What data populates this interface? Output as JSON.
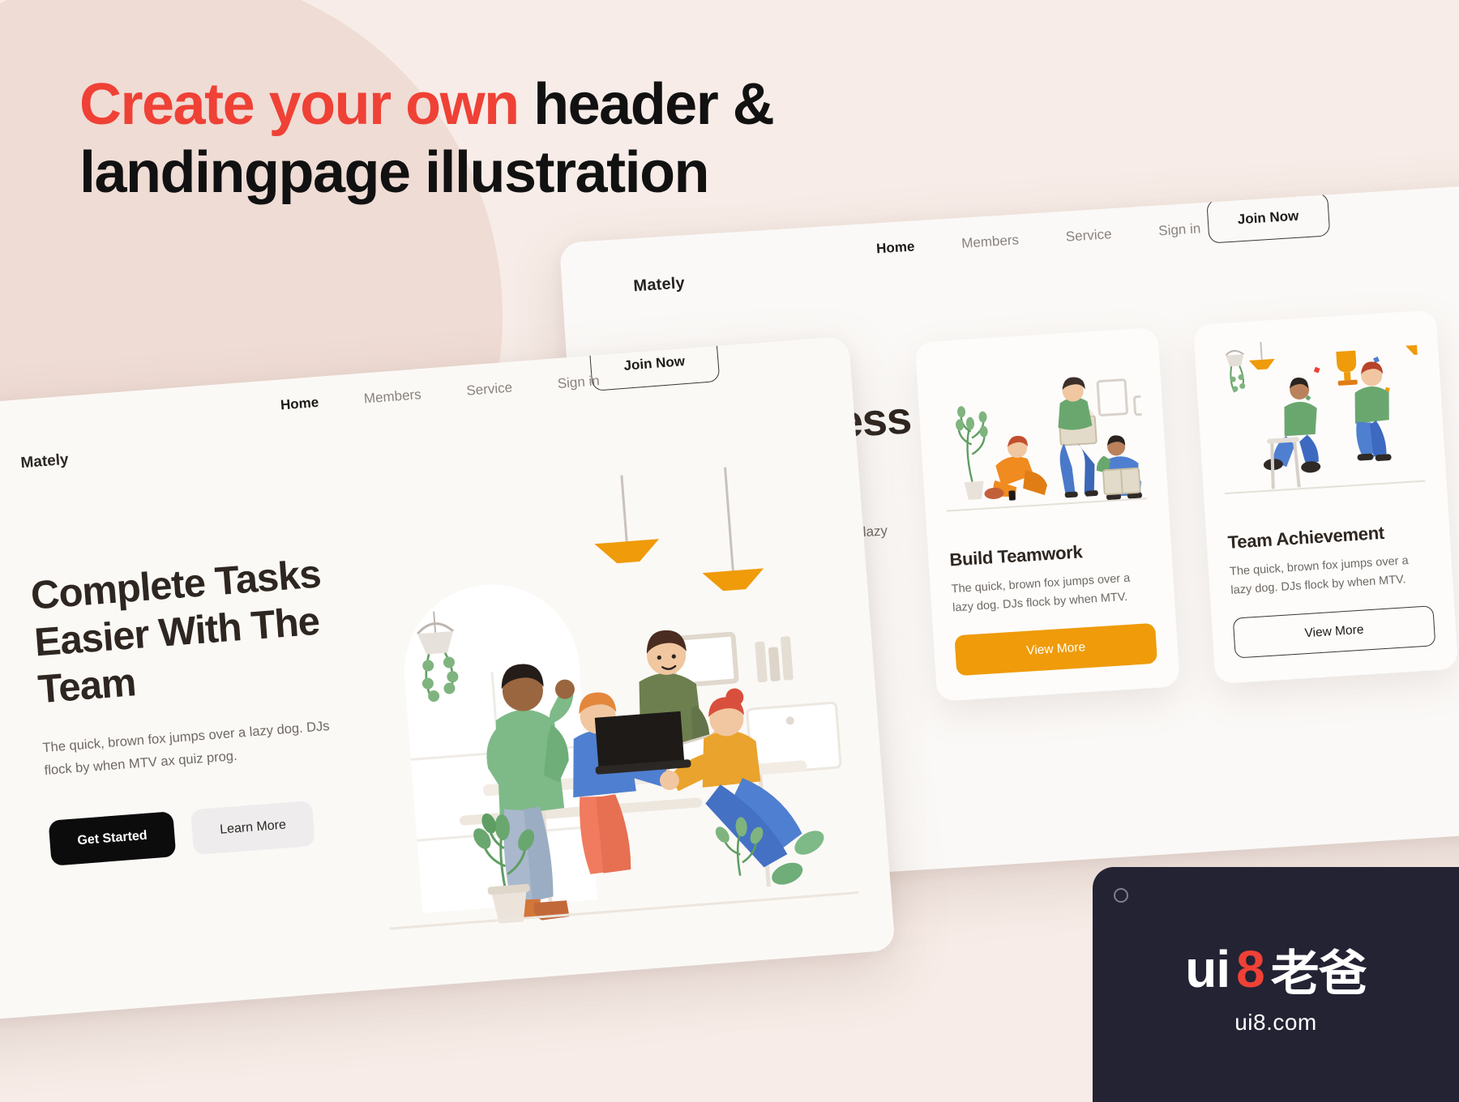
{
  "promo": {
    "line1_accent": "Create your own ",
    "line1_rest": "header &",
    "line2": "landingpage illustration",
    "accent_color": "#ef4136"
  },
  "front_mock": {
    "logo": "Mately",
    "nav": [
      {
        "label": "Home",
        "active": true
      },
      {
        "label": "Members",
        "active": false
      },
      {
        "label": "Service",
        "active": false
      },
      {
        "label": "Sign in",
        "active": false
      }
    ],
    "join_button": "Join Now",
    "hero": {
      "title": "Complete Tasks Easier With The Team",
      "paragraph": "The quick, brown fox jumps over a lazy dog. DJs flock by when MTV ax quiz prog.",
      "primary_button": "Get Started",
      "secondary_button": "Learn More"
    }
  },
  "back_mock": {
    "logo": "Mately",
    "nav": [
      {
        "label": "Home",
        "active": true
      },
      {
        "label": "Members",
        "active": false
      },
      {
        "label": "Service",
        "active": false
      },
      {
        "label": "Sign in",
        "active": false
      }
    ],
    "join_button": "Join Now",
    "hero": {
      "title": "The Success Is Your",
      "paragraph": "The quick, brown fox jumps over a lazy dog. DJs flock by when"
    },
    "cards": [
      {
        "title": "Build Teamwork",
        "paragraph": "The quick, brown fox jumps over a lazy dog. DJs flock by when MTV.",
        "button": "View More",
        "button_style": "solid",
        "button_color": "#ef9b0a"
      },
      {
        "title": "Team Achievement",
        "paragraph": "The quick, brown fox jumps over a lazy dog. DJs flock by when MTV.",
        "button": "View More",
        "button_style": "outline",
        "button_color": "#3a3531"
      }
    ]
  },
  "badge": {
    "logo_ui": "ui",
    "logo_8": "8",
    "logo_cn": "老爸",
    "url": "ui8.com"
  },
  "colors": {
    "page_bg": "#f7ece7",
    "blob": "#efdcd5",
    "card_bg": "#fbf9f7",
    "heading": "#2e2620",
    "body_text": "#6f6862",
    "accent_red": "#ef4136",
    "accent_orange": "#ef9b0a",
    "dark_button": "#0c0c0c",
    "badge_bg": "#232334"
  }
}
